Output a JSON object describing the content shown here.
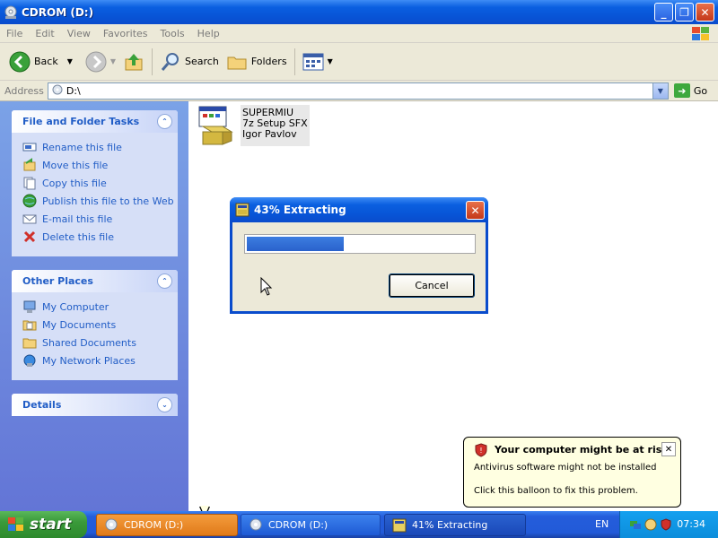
{
  "window": {
    "title": "CDROM (D:)"
  },
  "menu": [
    "File",
    "Edit",
    "View",
    "Favorites",
    "Tools",
    "Help"
  ],
  "toolbar": {
    "back": "Back",
    "search": "Search",
    "folders": "Folders"
  },
  "address": {
    "label": "Address",
    "value": "D:\\",
    "go": "Go"
  },
  "tasks_panel": {
    "title": "File and Folder Tasks",
    "items": [
      "Rename this file",
      "Move this file",
      "Copy this file",
      "Publish this file to the Web",
      "E-mail this file",
      "Delete this file"
    ]
  },
  "places_panel": {
    "title": "Other Places",
    "items": [
      "My Computer",
      "My Documents",
      "Shared Documents",
      "My Network Places"
    ]
  },
  "details_panel": {
    "title": "Details"
  },
  "file": {
    "name": "SUPERMIU",
    "type": "7z Setup SFX",
    "company": "Igor Pavlov"
  },
  "dialog": {
    "title": "43% Extracting",
    "progress": 0.43,
    "cancel": "Cancel"
  },
  "balloon": {
    "title": "Your computer might be at risk",
    "line1": "Antivirus software might not be installed",
    "line2": "Click this balloon to fix this problem."
  },
  "taskbar": {
    "start": "start",
    "tasks": [
      "CDROM (D:)",
      "CDROM (D:)",
      "41% Extracting"
    ],
    "language": "EN",
    "clock": "07:34"
  },
  "colors": {
    "accent": "#0a5fe0",
    "taskpane": "#6b8ee0",
    "link": "#215dc6",
    "balloon": "#ffffe1"
  }
}
